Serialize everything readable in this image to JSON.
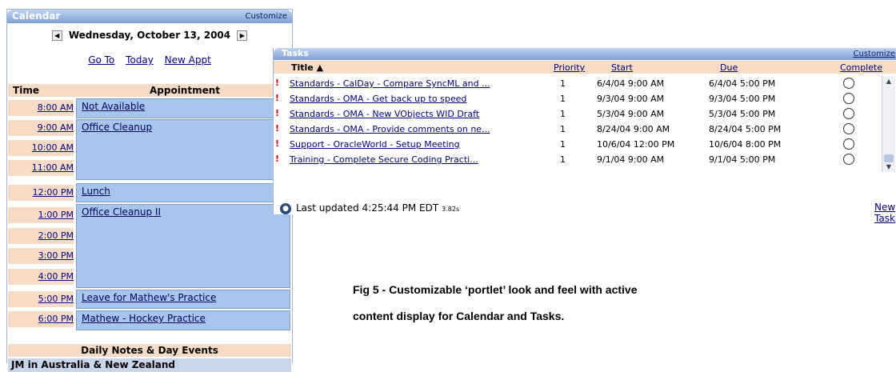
{
  "calendar": {
    "title": "Calendar",
    "customize": "Customize",
    "date": "Wednesday, October 13, 2004",
    "links": [
      "Go To",
      "Today",
      "New Appt"
    ],
    "col_time": "Time",
    "col_appt": "Appointment",
    "times": [
      "8:00 AM",
      "9:00 AM",
      "10:00 AM",
      "11:00 AM",
      "12:00 PM",
      "1:00 PM",
      "2:00 PM",
      "3:00 PM",
      "4:00 PM",
      "5:00 PM",
      "6:00 PM"
    ],
    "appointments": [
      "Not Available",
      "Office Cleanup",
      "Lunch",
      "Office Cleanup II",
      "Leave for Mathew's Practice",
      "Mathew - Hockey Practice"
    ],
    "notes_header": "Daily Notes & Day Events",
    "notes": [
      "JM in Australia & New Zealand"
    ]
  },
  "tasks": {
    "title": "Tasks",
    "customize": "Customize",
    "columns": {
      "title": "Title ▲",
      "priority": "Priority",
      "start": "Start",
      "due": "Due",
      "complete": "Complete"
    },
    "rows": [
      {
        "title": "Standards - CalDay - Compare SyncML and ...",
        "priority": "1",
        "start": "6/4/04 9:00 AM",
        "due": "6/4/04 5:00 PM"
      },
      {
        "title": "Standards - OMA - Get back up to speed",
        "priority": "1",
        "start": "9/3/04 9:00 AM",
        "due": "9/3/04 5:00 PM"
      },
      {
        "title": "Standards - OMA - New VObjects WID Draft",
        "priority": "1",
        "start": "5/3/04 9:00 AM",
        "due": "5/3/04 5:00 PM"
      },
      {
        "title": "Standards - OMA - Provide comments on ne...",
        "priority": "1",
        "start": "8/24/04 9:00 AM",
        "due": "8/24/04 5:00 PM"
      },
      {
        "title": "Support - OracleWorld - Setup Meeting",
        "priority": "1",
        "start": "10/6/04 12:00 PM",
        "due": "10/6/04 8:00 PM"
      },
      {
        "title": "Training - Complete Secure Coding Practi...",
        "priority": "1",
        "start": "9/1/04 9:00 AM",
        "due": "9/1/04 5:00 PM"
      }
    ],
    "updated": "Last updated 4:25:44 PM EDT",
    "updated_secs": "3.82s",
    "new_task": "New Task"
  },
  "caption": {
    "line1": "Fig 5 - Customizable ‘portlet’ look and feel with active",
    "line2": "content display for Calendar and Tasks."
  }
}
